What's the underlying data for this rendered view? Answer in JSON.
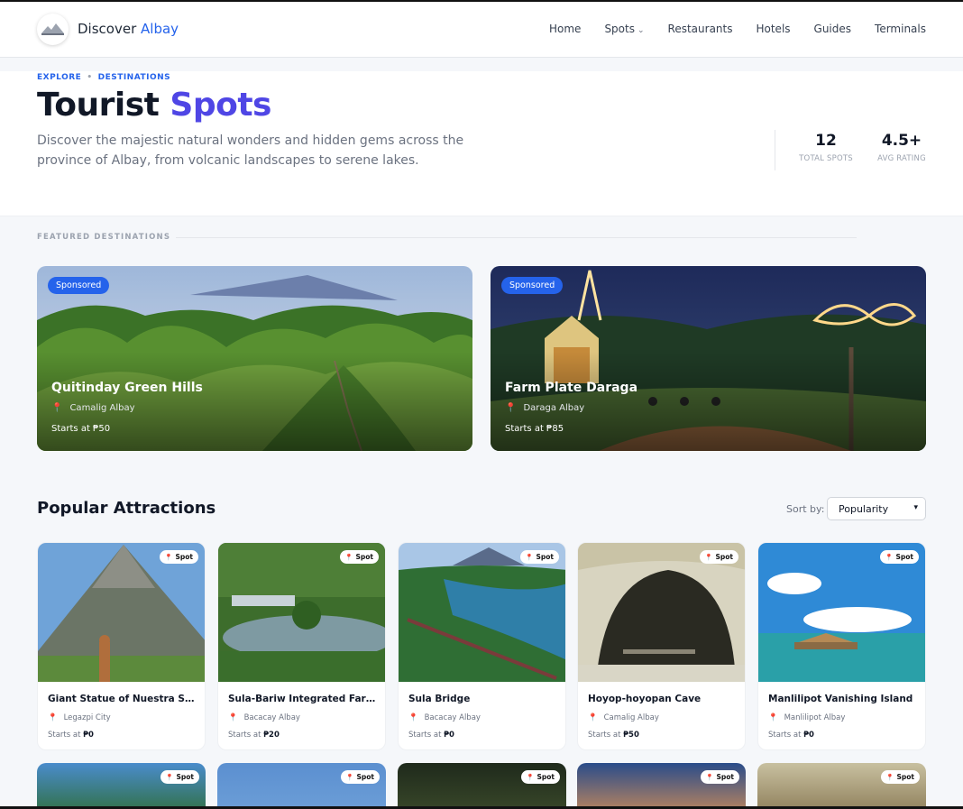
{
  "nav": {
    "brand_word": "Discover",
    "brand_accent": "Albay",
    "links": [
      "Home",
      "Spots",
      "Restaurants",
      "Hotels",
      "Guides",
      "Terminals"
    ]
  },
  "hero": {
    "breadcrumb": [
      "EXPLORE",
      "DESTINATIONS"
    ],
    "title_word": "Tourist",
    "title_accent": "Spots",
    "lead": "Discover the majestic natural wonders and hidden gems across the province of Albay, from volcanic landscapes to serene lakes.",
    "stats": [
      {
        "value": "12",
        "label": "TOTAL SPOTS"
      },
      {
        "value": "4.5+",
        "label": "AVG RATING"
      }
    ]
  },
  "featured": {
    "label": "FEATURED DESTINATIONS",
    "cards": [
      {
        "badge": "Sponsored",
        "title": "Quitinday Green Hills",
        "location": "Camalig Albay",
        "price": "Starts at ₱50"
      },
      {
        "badge": "Sponsored",
        "title": "Farm Plate Daraga",
        "location": "Daraga Albay",
        "price": "Starts at ₱85"
      }
    ]
  },
  "popular": {
    "title": "Popular Attractions",
    "sort_label": "Sort by:",
    "sort_value": "Popularity",
    "chip": "Spot",
    "price_prefix": "Starts at",
    "cards": [
      {
        "title": "Giant Statue of Nuestra Señora de Salvacion",
        "location": "Legazpi City",
        "price": "₱0"
      },
      {
        "title": "Sula-Bariw Integrated Farm Resort",
        "location": "Bacacay Albay",
        "price": "₱20"
      },
      {
        "title": "Sula Bridge",
        "location": "Bacacay Albay",
        "price": "₱0"
      },
      {
        "title": "Hoyop-hoyopan Cave",
        "location": "Camalig Albay",
        "price": "₱50"
      },
      {
        "title": "Manlilipot Vanishing Island",
        "location": "Manlilipot Albay",
        "price": "₱0"
      }
    ]
  },
  "colors": {
    "accent": "#2563eb",
    "title_accent": "#4f46e5",
    "pin": "#ef4444"
  }
}
